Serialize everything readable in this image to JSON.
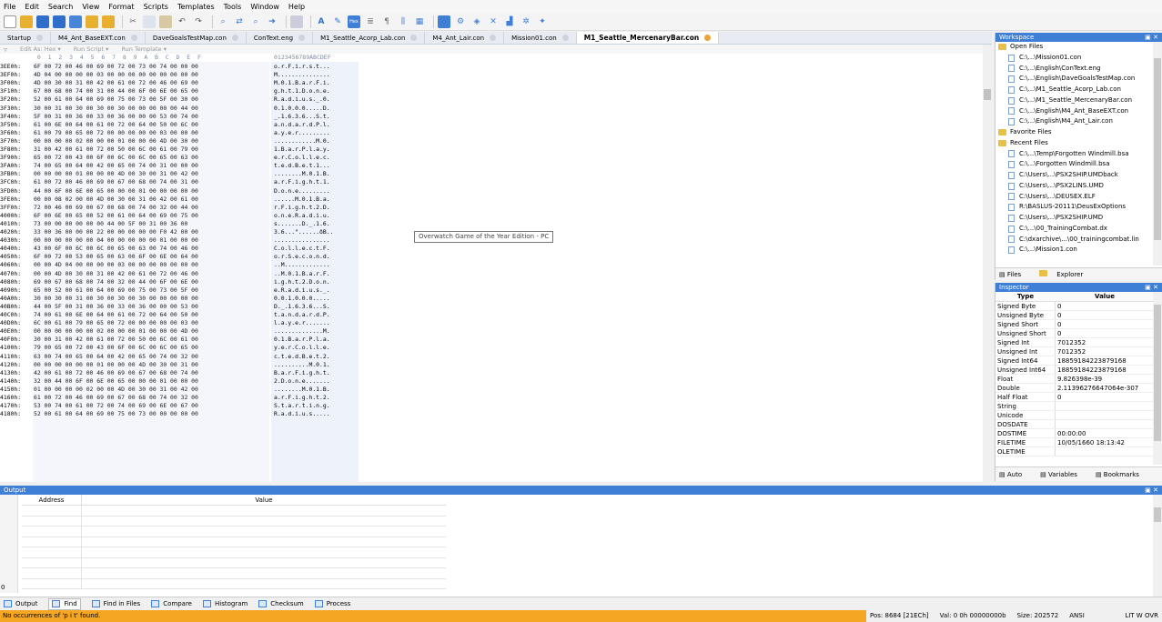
{
  "menu": [
    "File",
    "Edit",
    "Search",
    "View",
    "Format",
    "Scripts",
    "Templates",
    "Tools",
    "Window",
    "Help"
  ],
  "tabs": [
    {
      "label": "Startup",
      "active": false
    },
    {
      "label": "M4_Ant_BaseEXT.con",
      "active": false
    },
    {
      "label": "DaveGoalsTestMap.con",
      "active": false
    },
    {
      "label": "ConText.eng",
      "active": false
    },
    {
      "label": "M1_Seattle_Acorp_Lab.con",
      "active": false
    },
    {
      "label": "M4_Ant_Lair.con",
      "active": false
    },
    {
      "label": "Mission01.con",
      "active": false
    },
    {
      "label": "M1_Seattle_MercenaryBar.con",
      "active": true
    }
  ],
  "editor": {
    "edit_as": "Edit As: Hex ▾",
    "run_script": "Run Script ▾",
    "run_template": "Run Template ▾",
    "hex_header": " 0  1  2  3  4  5  6  7  8  9  A  B  C  D  E  F",
    "ascii_header": "0123456789ABCDEF",
    "rows": [
      {
        "addr": "3EE0h:",
        "hex": "6F 00 72 00 46 00 69 00 72 00 73 00 74 00 00 00",
        "ascii": "o.r.F.i.r.s.t..."
      },
      {
        "addr": "3EF0h:",
        "hex": "4D 04 00 00 00 00 03 00 00 00 00 00 00 00 00 00",
        "ascii": "M..............."
      },
      {
        "addr": "3F00h:",
        "hex": "4D 00 30 00 31 00 42 00 61 00 72 00 46 00 69 00",
        "ascii": "M.0.1.B.a.r.F.i."
      },
      {
        "addr": "3F10h:",
        "hex": "67 00 68 00 74 00 31 00 44 00 6F 00 6E 00 65 00",
        "ascii": "g.h.t.1.D.o.n.e."
      },
      {
        "addr": "3F20h:",
        "hex": "52 00 61 00 64 00 69 00 75 00 73 00 5F 00 30 00",
        "ascii": "R.a.d.i.u.s._.0."
      },
      {
        "addr": "3F30h:",
        "hex": "30 00 31 00 30 00 30 00 30 00 00 00 00 00 44 00",
        "ascii": "0.1.0.0.0.....D."
      },
      {
        "addr": "3F40h:",
        "hex": "5F 00 31 00 36 00 33 00 36 00 00 00 53 00 74 00",
        "ascii": "_.1.6.3.6...S.t."
      },
      {
        "addr": "3F50h:",
        "hex": "61 00 6E 00 64 00 61 00 72 00 64 00 50 00 6C 00",
        "ascii": "a.n.d.a.r.d.P.l."
      },
      {
        "addr": "3F60h:",
        "hex": "61 00 79 00 65 00 72 00 00 00 00 00 03 00 00 00",
        "ascii": "a.y.e.r........."
      },
      {
        "addr": "3F70h:",
        "hex": "00 00 00 00 02 00 00 00 01 00 00 00 4D 00 30 00",
        "ascii": "............M.0."
      },
      {
        "addr": "3F80h:",
        "hex": "31 00 42 00 61 00 72 00 50 00 6C 00 61 00 79 00",
        "ascii": "1.B.a.r.P.l.a.y."
      },
      {
        "addr": "3F90h:",
        "hex": "65 00 72 00 43 00 6F 00 6C 00 6C 00 65 00 63 00",
        "ascii": "e.r.C.o.l.l.e.c."
      },
      {
        "addr": "3FA0h:",
        "hex": "74 00 65 00 64 00 42 00 65 00 74 00 31 00 00 00",
        "ascii": "t.e.d.B.e.t.1..."
      },
      {
        "addr": "3FB0h:",
        "hex": "00 00 00 00 01 00 00 00 4D 00 30 00 31 00 42 00",
        "ascii": "........M.0.1.B."
      },
      {
        "addr": "3FC0h:",
        "hex": "61 00 72 00 46 00 69 00 67 00 68 00 74 00 31 00",
        "ascii": "a.r.F.i.g.h.t.1."
      },
      {
        "addr": "3FD0h:",
        "hex": "44 00 6F 00 6E 00 65 00 00 00 01 00 00 00 00 00",
        "ascii": "D.o.n.e........."
      },
      {
        "addr": "3FE0h:",
        "hex": "00 00 08 02 00 00 4D 00 30 00 31 00 42 00 61 00",
        "ascii": "......M.0.1.B.a."
      },
      {
        "addr": "3FF0h:",
        "hex": "72 00 46 00 69 00 67 00 68 00 74 00 32 00 44 00",
        "ascii": "r.F.i.g.h.t.2.D."
      },
      {
        "addr": "4000h:",
        "hex": "6F 00 6E 00 65 00 52 00 61 00 64 00 69 00 75 00",
        "ascii": "o.n.e.R.a.d.i.u."
      },
      {
        "addr": "4010h:",
        "hex": "73 00 00 00 00 00 00 44 00 5F 00 31 00 36 00",
        "ascii": "s.......D._.1.6."
      },
      {
        "addr": "4020h:",
        "hex": "33 00 36 00 00 00 22 00 00 00 00 00 F0 42 00 00",
        "ascii": "3.6...\"......ðB.."
      },
      {
        "addr": "4030h:",
        "hex": "00 00 00 00 00 00 04 00 00 00 00 00 01 00 00 00",
        "ascii": "................"
      },
      {
        "addr": "4040h:",
        "hex": "43 00 6F 00 6C 00 6C 00 65 00 63 00 74 00 46 00",
        "ascii": "C.o.l.l.e.c.t.F."
      },
      {
        "addr": "4050h:",
        "hex": "6F 00 72 00 53 00 65 00 63 00 6F 00 6E 00 64 00",
        "ascii": "o.r.S.e.c.o.n.d."
      },
      {
        "addr": "4060h:",
        "hex": "00 00 4D 04 00 00 00 00 03 00 00 00 00 00 00 00",
        "ascii": "..M............."
      },
      {
        "addr": "4070h:",
        "hex": "00 00 4D 00 30 00 31 00 42 00 61 00 72 00 46 00",
        "ascii": "..M.0.1.B.a.r.F."
      },
      {
        "addr": "4080h:",
        "hex": "69 00 67 00 68 00 74 00 32 00 44 00 6F 00 6E 00",
        "ascii": "i.g.h.t.2.D.o.n."
      },
      {
        "addr": "4090h:",
        "hex": "65 00 52 00 61 00 64 00 69 00 75 00 73 00 5F 00",
        "ascii": "e.R.a.d.i.u.s._."
      },
      {
        "addr": "40A0h:",
        "hex": "30 00 30 00 31 00 30 00 30 00 30 00 00 00 00 00",
        "ascii": "0.0.1.0.0.0....."
      },
      {
        "addr": "40B0h:",
        "hex": "44 00 5F 00 31 00 36 00 33 00 36 00 00 00 53 00",
        "ascii": "D._.1.6.3.6...S."
      },
      {
        "addr": "40C0h:",
        "hex": "74 00 61 00 6E 00 64 00 61 00 72 00 64 00 50 00",
        "ascii": "t.a.n.d.a.r.d.P."
      },
      {
        "addr": "40D0h:",
        "hex": "6C 00 61 00 79 00 65 00 72 00 00 00 00 00 03 00",
        "ascii": "l.a.y.e.r......."
      },
      {
        "addr": "40E0h:",
        "hex": "00 00 00 00 00 00 02 00 00 00 01 00 00 00 4D 00",
        "ascii": "..............M."
      },
      {
        "addr": "40F0h:",
        "hex": "30 00 31 00 42 00 61 00 72 00 50 00 6C 00 61 00",
        "ascii": "0.1.B.a.r.P.l.a."
      },
      {
        "addr": "4100h:",
        "hex": "79 00 65 00 72 00 43 00 6F 00 6C 00 6C 00 65 00",
        "ascii": "y.e.r.C.o.l.l.e."
      },
      {
        "addr": "4110h:",
        "hex": "63 00 74 00 65 00 64 00 42 00 65 00 74 00 32 00",
        "ascii": "c.t.e.d.B.e.t.2."
      },
      {
        "addr": "4120h:",
        "hex": "00 00 00 00 00 00 01 00 00 00 4D 00 30 00 31 00",
        "ascii": "..........M.0.1."
      },
      {
        "addr": "4130h:",
        "hex": "42 00 61 00 72 00 46 00 69 00 67 00 68 00 74 00",
        "ascii": "B.a.r.F.i.g.h.t."
      },
      {
        "addr": "4140h:",
        "hex": "32 00 44 00 6F 00 6E 00 65 00 00 00 01 00 00 00",
        "ascii": "2.D.o.n.e......."
      },
      {
        "addr": "4150h:",
        "hex": "01 00 00 00 00 02 00 00 4D 00 30 00 31 00 42 00",
        "ascii": "........M.0.1.B."
      },
      {
        "addr": "4160h:",
        "hex": "61 00 72 00 46 00 69 00 67 00 68 00 74 00 32 00",
        "ascii": "a.r.F.i.g.h.t.2."
      },
      {
        "addr": "4170h:",
        "hex": "53 00 74 00 61 00 72 00 74 00 69 00 6E 00 67 00",
        "ascii": "S.t.a.r.t.i.n.g."
      },
      {
        "addr": "4180h:",
        "hex": "52 00 61 00 64 00 69 00 75 00 73 00 00 00 00 00",
        "ascii": "R.a.d.i.u.s....."
      }
    ]
  },
  "tooltip": "Overwatch Game of the Year Edition - PC",
  "workspace": {
    "title": "Workspace",
    "items": [
      {
        "label": "Open Files",
        "type": "folder",
        "indent": 0
      },
      {
        "label": "C:\\...\\Mission01.con",
        "type": "file",
        "indent": 1
      },
      {
        "label": "C:\\...\\English\\ConText.eng",
        "type": "file",
        "indent": 1
      },
      {
        "label": "C:\\...\\English\\DaveGoalsTestMap.con",
        "type": "file",
        "indent": 1
      },
      {
        "label": "C:\\...\\M1_Seattle_Acorp_Lab.con",
        "type": "file",
        "indent": 1
      },
      {
        "label": "C:\\...\\M1_Seattle_MercenaryBar.con",
        "type": "file",
        "indent": 1
      },
      {
        "label": "C:\\...\\English\\M4_Ant_BaseEXT.con",
        "type": "file",
        "indent": 1
      },
      {
        "label": "C:\\...\\English\\M4_Ant_Lair.con",
        "type": "file",
        "indent": 1
      },
      {
        "label": "Favorite Files",
        "type": "folder",
        "indent": 0
      },
      {
        "label": "Recent Files",
        "type": "folder",
        "indent": 0
      },
      {
        "label": "C:\\...\\Temp\\Forgotten Windmill.bsa",
        "type": "file",
        "indent": 1
      },
      {
        "label": "C:\\...\\Forgotten Windmill.bsa",
        "type": "file",
        "indent": 1
      },
      {
        "label": "C:\\Users\\...\\PSX2SHIP.UMDback",
        "type": "file",
        "indent": 1
      },
      {
        "label": "C:\\Users\\...\\PSX2LINS.UMD",
        "type": "file",
        "indent": 1
      },
      {
        "label": "C:\\Users\\...\\DEUSEX.ELF",
        "type": "file",
        "indent": 1
      },
      {
        "label": "R:\\BASLUS-20111\\DeusExOptions",
        "type": "file",
        "indent": 1
      },
      {
        "label": "C:\\Users\\...\\PSX2SHIP.UMD",
        "type": "file",
        "indent": 1
      },
      {
        "label": "C:\\...\\00_TrainingCombat.dx",
        "type": "file",
        "indent": 1
      },
      {
        "label": "C:\\dxarchive\\...\\00_trainingcombat.lin",
        "type": "file",
        "indent": 1
      },
      {
        "label": "C:\\...\\Mission1.con",
        "type": "file",
        "indent": 1
      }
    ],
    "foot_tabs": [
      "Files",
      "Explorer"
    ]
  },
  "inspector": {
    "title": "Inspector",
    "col_type": "Type",
    "col_value": "Value",
    "rows": [
      {
        "type": "Signed Byte",
        "value": "0"
      },
      {
        "type": "Unsigned Byte",
        "value": "0"
      },
      {
        "type": "Signed Short",
        "value": "0"
      },
      {
        "type": "Unsigned Short",
        "value": "0"
      },
      {
        "type": "Signed Int",
        "value": "7012352"
      },
      {
        "type": "Unsigned Int",
        "value": "7012352"
      },
      {
        "type": "Signed Int64",
        "value": "18859184223879168"
      },
      {
        "type": "Unsigned Int64",
        "value": "18859184223879168"
      },
      {
        "type": "Float",
        "value": "9.826398e-39"
      },
      {
        "type": "Double",
        "value": "2.11396276647064e-307"
      },
      {
        "type": "Half Float",
        "value": "0"
      },
      {
        "type": "String",
        "value": ""
      },
      {
        "type": "Unicode",
        "value": ""
      },
      {
        "type": "DOSDATE",
        "value": ""
      },
      {
        "type": "DOSTIME",
        "value": "00:00:00"
      },
      {
        "type": "FILETIME",
        "value": "10/05/1660 18:13:42"
      },
      {
        "type": "OLETIME",
        "value": ""
      }
    ],
    "foot_tabs": [
      "Auto",
      "Variables",
      "Bookmarks"
    ]
  },
  "output": {
    "title": "Output",
    "col_address": "Address",
    "col_value": "Value",
    "left_number": "0"
  },
  "bottom_tabs": [
    "Output",
    "Find",
    "Find in Files",
    "Compare",
    "Histogram",
    "Checksum",
    "Process"
  ],
  "status": {
    "message": "No occurrences of 'p i t' found.",
    "pos": "Pos: 8684 [21ECh]",
    "val": "Val: 0 0h 00000000b",
    "size": "Size: 202572",
    "encoding": "ANSI",
    "modes": "LIT  W  OVR"
  },
  "colors": {
    "accent": "#3f7fd6",
    "status_bar": "#f5a623",
    "active_tab_close": "#e8a33a"
  }
}
